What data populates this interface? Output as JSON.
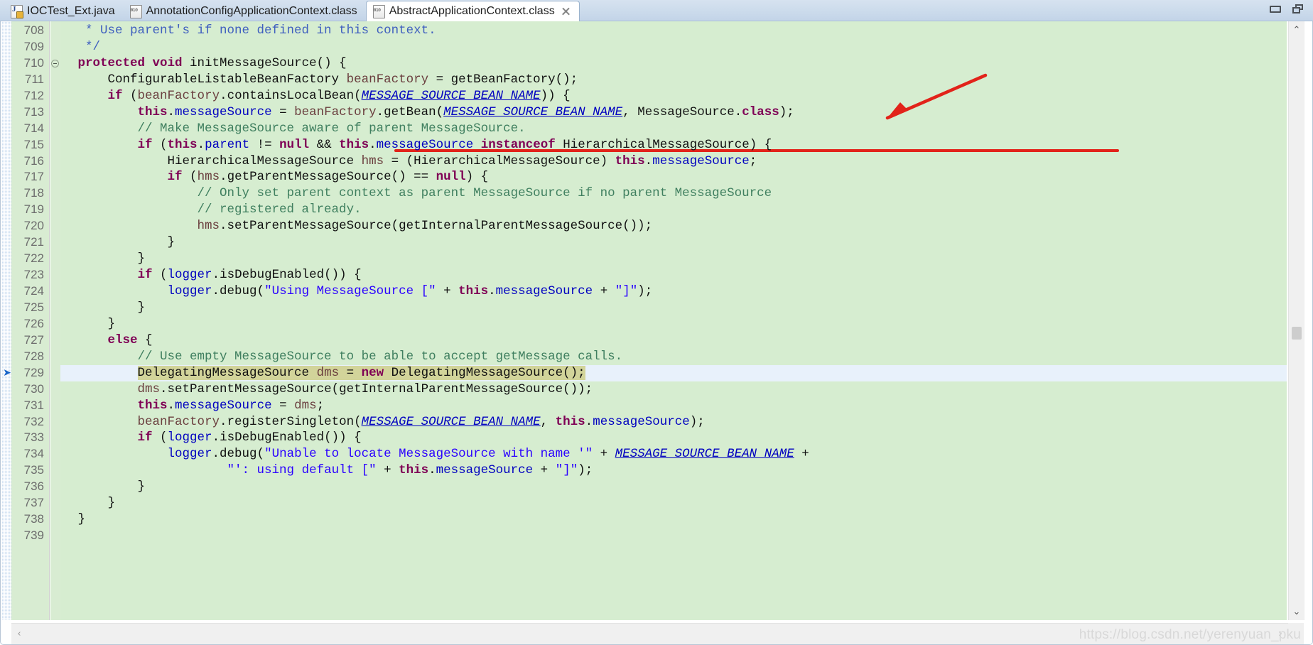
{
  "window": {
    "minimize_label": "minimize",
    "restore_label": "restore"
  },
  "tabs": [
    {
      "label": "IOCTest_Ext.java",
      "icon": "java-file-icon",
      "active": false,
      "closable": false
    },
    {
      "label": "AnnotationConfigApplicationContext.class",
      "icon": "class-file-icon",
      "active": false,
      "closable": false
    },
    {
      "label": "AbstractApplicationContext.class",
      "icon": "class-file-icon",
      "active": true,
      "closable": true
    }
  ],
  "editor": {
    "first_line": 708,
    "current_line": 729,
    "lines": [
      {
        "n": 708,
        "fold": false,
        "tokens": [
          {
            "t": "  * Use parent's if none defined in this context.",
            "c": "jdoc"
          }
        ]
      },
      {
        "n": 709,
        "fold": false,
        "tokens": [
          {
            "t": "  */",
            "c": "jdoc"
          }
        ]
      },
      {
        "n": 710,
        "fold": true,
        "tokens": [
          {
            "t": " ",
            "c": "plain"
          },
          {
            "t": "protected void",
            "c": "kw"
          },
          {
            "t": " initMessageSource() {",
            "c": "plain"
          }
        ]
      },
      {
        "n": 711,
        "fold": false,
        "tokens": [
          {
            "t": "     ConfigurableListableBeanFactory ",
            "c": "plain"
          },
          {
            "t": "beanFactory",
            "c": "local"
          },
          {
            "t": " = getBeanFactory();",
            "c": "plain"
          }
        ]
      },
      {
        "n": 712,
        "fold": false,
        "tokens": [
          {
            "t": "     ",
            "c": "plain"
          },
          {
            "t": "if",
            "c": "kw"
          },
          {
            "t": " (",
            "c": "plain"
          },
          {
            "t": "beanFactory",
            "c": "local"
          },
          {
            "t": ".containsLocalBean(",
            "c": "plain"
          },
          {
            "t": "MESSAGE_SOURCE_BEAN_NAME",
            "c": "stat"
          },
          {
            "t": ")) {",
            "c": "plain"
          }
        ]
      },
      {
        "n": 713,
        "fold": false,
        "tokens": [
          {
            "t": "         ",
            "c": "plain"
          },
          {
            "t": "this",
            "c": "kw"
          },
          {
            "t": ".",
            "c": "plain"
          },
          {
            "t": "messageSource",
            "c": "fld"
          },
          {
            "t": " = ",
            "c": "plain"
          },
          {
            "t": "beanFactory",
            "c": "local"
          },
          {
            "t": ".getBean(",
            "c": "plain"
          },
          {
            "t": "MESSAGE_SOURCE_BEAN_NAME",
            "c": "stat"
          },
          {
            "t": ", MessageSource.",
            "c": "plain"
          },
          {
            "t": "class",
            "c": "kw"
          },
          {
            "t": ");",
            "c": "plain"
          }
        ]
      },
      {
        "n": 714,
        "fold": false,
        "tokens": [
          {
            "t": "         // Make MessageSource aware of parent MessageSource.",
            "c": "cmt"
          }
        ]
      },
      {
        "n": 715,
        "fold": false,
        "tokens": [
          {
            "t": "         ",
            "c": "plain"
          },
          {
            "t": "if",
            "c": "kw"
          },
          {
            "t": " (",
            "c": "plain"
          },
          {
            "t": "this",
            "c": "kw"
          },
          {
            "t": ".",
            "c": "plain"
          },
          {
            "t": "parent",
            "c": "fld"
          },
          {
            "t": " != ",
            "c": "plain"
          },
          {
            "t": "null",
            "c": "kw"
          },
          {
            "t": " && ",
            "c": "plain"
          },
          {
            "t": "this",
            "c": "kw"
          },
          {
            "t": ".",
            "c": "plain"
          },
          {
            "t": "messageSource",
            "c": "fld"
          },
          {
            "t": " ",
            "c": "plain"
          },
          {
            "t": "instanceof",
            "c": "kw"
          },
          {
            "t": " HierarchicalMessageSource) {",
            "c": "plain"
          }
        ]
      },
      {
        "n": 716,
        "fold": false,
        "tokens": [
          {
            "t": "             HierarchicalMessageSource ",
            "c": "plain"
          },
          {
            "t": "hms",
            "c": "local"
          },
          {
            "t": " = (HierarchicalMessageSource) ",
            "c": "plain"
          },
          {
            "t": "this",
            "c": "kw"
          },
          {
            "t": ".",
            "c": "plain"
          },
          {
            "t": "messageSource",
            "c": "fld"
          },
          {
            "t": ";",
            "c": "plain"
          }
        ]
      },
      {
        "n": 717,
        "fold": false,
        "tokens": [
          {
            "t": "             ",
            "c": "plain"
          },
          {
            "t": "if",
            "c": "kw"
          },
          {
            "t": " (",
            "c": "plain"
          },
          {
            "t": "hms",
            "c": "local"
          },
          {
            "t": ".getParentMessageSource() == ",
            "c": "plain"
          },
          {
            "t": "null",
            "c": "kw"
          },
          {
            "t": ") {",
            "c": "plain"
          }
        ]
      },
      {
        "n": 718,
        "fold": false,
        "tokens": [
          {
            "t": "                 // Only set parent context as parent MessageSource if no parent MessageSource",
            "c": "cmt"
          }
        ]
      },
      {
        "n": 719,
        "fold": false,
        "tokens": [
          {
            "t": "                 // registered already.",
            "c": "cmt"
          }
        ]
      },
      {
        "n": 720,
        "fold": false,
        "tokens": [
          {
            "t": "                 ",
            "c": "plain"
          },
          {
            "t": "hms",
            "c": "local"
          },
          {
            "t": ".setParentMessageSource(getInternalParentMessageSource());",
            "c": "plain"
          }
        ]
      },
      {
        "n": 721,
        "fold": false,
        "tokens": [
          {
            "t": "             }",
            "c": "plain"
          }
        ]
      },
      {
        "n": 722,
        "fold": false,
        "tokens": [
          {
            "t": "         }",
            "c": "plain"
          }
        ]
      },
      {
        "n": 723,
        "fold": false,
        "tokens": [
          {
            "t": "         ",
            "c": "plain"
          },
          {
            "t": "if",
            "c": "kw"
          },
          {
            "t": " (",
            "c": "plain"
          },
          {
            "t": "logger",
            "c": "fld"
          },
          {
            "t": ".isDebugEnabled()) {",
            "c": "plain"
          }
        ]
      },
      {
        "n": 724,
        "fold": false,
        "tokens": [
          {
            "t": "             ",
            "c": "plain"
          },
          {
            "t": "logger",
            "c": "fld"
          },
          {
            "t": ".debug(",
            "c": "plain"
          },
          {
            "t": "\"Using MessageSource [\"",
            "c": "str"
          },
          {
            "t": " + ",
            "c": "plain"
          },
          {
            "t": "this",
            "c": "kw"
          },
          {
            "t": ".",
            "c": "plain"
          },
          {
            "t": "messageSource",
            "c": "fld"
          },
          {
            "t": " + ",
            "c": "plain"
          },
          {
            "t": "\"]\"",
            "c": "str"
          },
          {
            "t": ");",
            "c": "plain"
          }
        ]
      },
      {
        "n": 725,
        "fold": false,
        "tokens": [
          {
            "t": "         }",
            "c": "plain"
          }
        ]
      },
      {
        "n": 726,
        "fold": false,
        "tokens": [
          {
            "t": "     }",
            "c": "plain"
          }
        ]
      },
      {
        "n": 727,
        "fold": false,
        "tokens": [
          {
            "t": "     ",
            "c": "plain"
          },
          {
            "t": "else",
            "c": "kw"
          },
          {
            "t": " {",
            "c": "plain"
          }
        ]
      },
      {
        "n": 728,
        "fold": false,
        "tokens": [
          {
            "t": "         // Use empty MessageSource to be able to accept getMessage calls.",
            "c": "cmt"
          }
        ]
      },
      {
        "n": 729,
        "fold": false,
        "current": true,
        "tokens": [
          {
            "t": "         ",
            "c": "plain"
          },
          {
            "t": "DelegatingMessageSource ",
            "c": "plain",
            "hl": true
          },
          {
            "t": "dms",
            "c": "local",
            "hl": true
          },
          {
            "t": " = ",
            "c": "plain",
            "hl": true
          },
          {
            "t": "new",
            "c": "kw",
            "hl": true
          },
          {
            "t": " DelegatingMessageSource();",
            "c": "plain",
            "hl": true
          }
        ]
      },
      {
        "n": 730,
        "fold": false,
        "tokens": [
          {
            "t": "         ",
            "c": "plain"
          },
          {
            "t": "dms",
            "c": "local"
          },
          {
            "t": ".setParentMessageSource(getInternalParentMessageSource());",
            "c": "plain"
          }
        ]
      },
      {
        "n": 731,
        "fold": false,
        "tokens": [
          {
            "t": "         ",
            "c": "plain"
          },
          {
            "t": "this",
            "c": "kw"
          },
          {
            "t": ".",
            "c": "plain"
          },
          {
            "t": "messageSource",
            "c": "fld"
          },
          {
            "t": " = ",
            "c": "plain"
          },
          {
            "t": "dms",
            "c": "local"
          },
          {
            "t": ";",
            "c": "plain"
          }
        ]
      },
      {
        "n": 732,
        "fold": false,
        "tokens": [
          {
            "t": "         ",
            "c": "plain"
          },
          {
            "t": "beanFactory",
            "c": "local"
          },
          {
            "t": ".registerSingleton(",
            "c": "plain"
          },
          {
            "t": "MESSAGE_SOURCE_BEAN_NAME",
            "c": "stat"
          },
          {
            "t": ", ",
            "c": "plain"
          },
          {
            "t": "this",
            "c": "kw"
          },
          {
            "t": ".",
            "c": "plain"
          },
          {
            "t": "messageSource",
            "c": "fld"
          },
          {
            "t": ");",
            "c": "plain"
          }
        ]
      },
      {
        "n": 733,
        "fold": false,
        "tokens": [
          {
            "t": "         ",
            "c": "plain"
          },
          {
            "t": "if",
            "c": "kw"
          },
          {
            "t": " (",
            "c": "plain"
          },
          {
            "t": "logger",
            "c": "fld"
          },
          {
            "t": ".isDebugEnabled()) {",
            "c": "plain"
          }
        ]
      },
      {
        "n": 734,
        "fold": false,
        "tokens": [
          {
            "t": "             ",
            "c": "plain"
          },
          {
            "t": "logger",
            "c": "fld"
          },
          {
            "t": ".debug(",
            "c": "plain"
          },
          {
            "t": "\"Unable to locate MessageSource with name '\"",
            "c": "str"
          },
          {
            "t": " + ",
            "c": "plain"
          },
          {
            "t": "MESSAGE_SOURCE_BEAN_NAME",
            "c": "stat"
          },
          {
            "t": " +",
            "c": "plain"
          }
        ]
      },
      {
        "n": 735,
        "fold": false,
        "tokens": [
          {
            "t": "                     ",
            "c": "plain"
          },
          {
            "t": "\"': using default [\"",
            "c": "str"
          },
          {
            "t": " + ",
            "c": "plain"
          },
          {
            "t": "this",
            "c": "kw"
          },
          {
            "t": ".",
            "c": "plain"
          },
          {
            "t": "messageSource",
            "c": "fld"
          },
          {
            "t": " + ",
            "c": "plain"
          },
          {
            "t": "\"]\"",
            "c": "str"
          },
          {
            "t": ");",
            "c": "plain"
          }
        ]
      },
      {
        "n": 736,
        "fold": false,
        "tokens": [
          {
            "t": "         }",
            "c": "plain"
          }
        ]
      },
      {
        "n": 737,
        "fold": false,
        "tokens": [
          {
            "t": "     }",
            "c": "plain"
          }
        ]
      },
      {
        "n": 738,
        "fold": false,
        "tokens": [
          {
            "t": " }",
            "c": "plain"
          }
        ]
      },
      {
        "n": 739,
        "fold": false,
        "tokens": [
          {
            "t": "",
            "c": "plain"
          }
        ]
      }
    ]
  },
  "annotations": {
    "arrow_color": "#e2231a",
    "underline_color": "#e2231a",
    "description": "red hand-drawn arrow pointing to MessageSource.class on line 713 with red underline under the getBean(...) call"
  },
  "scrollbars": {
    "v_up_glyph": "⌃",
    "v_down_glyph": "⌄",
    "h_left_glyph": "‹",
    "h_right_glyph": "›"
  },
  "watermark": {
    "text": "https://blog.csdn.net/yerenyuan_pku"
  }
}
